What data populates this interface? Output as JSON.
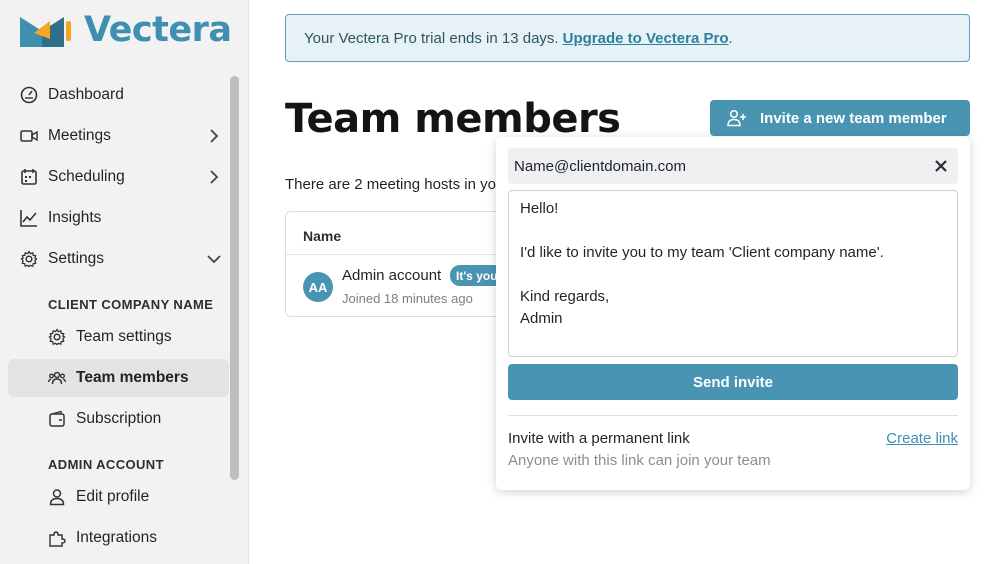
{
  "brand": {
    "name": "Vectera",
    "logo_text_color": "#3f8fb0",
    "logo_colors": [
      "#3f8fb0",
      "#f5a623"
    ]
  },
  "colors": {
    "accent": "#4a94b3",
    "banner_bg": "#e6f2f6",
    "link": "#3f8fb0"
  },
  "sidebar": {
    "nav": [
      {
        "label": "Dashboard",
        "icon": "dashboard-icon"
      },
      {
        "label": "Meetings",
        "icon": "video-icon",
        "chevron": "chevron-right-icon"
      },
      {
        "label": "Scheduling",
        "icon": "calendar-icon",
        "chevron": "chevron-right-icon"
      },
      {
        "label": "Insights",
        "icon": "chart-icon"
      },
      {
        "label": "Settings",
        "icon": "gear-icon",
        "chevron": "chevron-down-icon"
      }
    ],
    "company_section": {
      "label": "CLIENT COMPANY NAME",
      "items": [
        {
          "label": "Team settings",
          "icon": "gear-icon"
        },
        {
          "label": "Team members",
          "icon": "users-icon",
          "active": true
        },
        {
          "label": "Subscription",
          "icon": "wallet-icon"
        }
      ]
    },
    "admin_section": {
      "label": "ADMIN ACCOUNT",
      "items": [
        {
          "label": "Edit profile",
          "icon": "user-icon"
        },
        {
          "label": "Integrations",
          "icon": "puzzle-icon"
        }
      ]
    }
  },
  "banner": {
    "text": "Your Vectera Pro trial ends in 13 days.",
    "link": "Upgrade to Vectera Pro",
    "suffix": "."
  },
  "main": {
    "title": "Team members",
    "invite_button": "Invite a new team member",
    "hosts_text": "There are 2 meeting hosts in yo",
    "table": {
      "column_name": "Name",
      "rows": [
        {
          "initials": "AA",
          "name": "Admin account",
          "badge": "It's you",
          "joined": "Joined 18 minutes ago"
        }
      ]
    }
  },
  "invite_popover": {
    "email_value": "Name@clientdomain.com",
    "message": "Hello!\n\nI'd like to invite you to my team 'Client company name'.\n\nKind regards,\nAdmin",
    "send_label": "Send invite",
    "permanent_link_title": "Invite with a permanent link",
    "permanent_link_subtitle": "Anyone with this link can join your team",
    "create_link_label": "Create link"
  }
}
